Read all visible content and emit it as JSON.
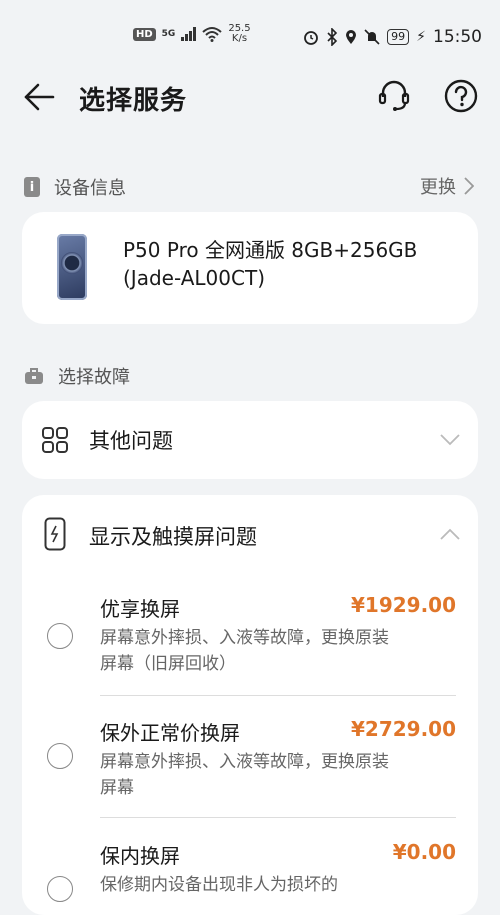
{
  "status_bar": {
    "network_badge": "HD",
    "network_type": "5G",
    "speed_value": "25.5",
    "speed_unit": "K/s",
    "battery": "99",
    "time": "15:50"
  },
  "header": {
    "title": "选择服务"
  },
  "device_section": {
    "label": "设备信息",
    "change_label": "更换",
    "device_name": "P50 Pro 全网通版 8GB+256GB (Jade-AL00CT)"
  },
  "fault_section": {
    "label": "选择故障",
    "other_issue": "其他问题",
    "screen_issue": "显示及触摸屏问题"
  },
  "options": [
    {
      "title": "优享换屏",
      "price": "¥1929.00",
      "desc": "屏幕意外摔损、入液等故障，更换原装屏幕（旧屏回收）"
    },
    {
      "title": "保外正常价换屏",
      "price": "¥2729.00",
      "desc": "屏幕意外摔损、入液等故障，更换原装屏幕"
    },
    {
      "title": "保内换屏",
      "price": "¥0.00",
      "desc": "保修期内设备出现非人为损坏的"
    }
  ]
}
